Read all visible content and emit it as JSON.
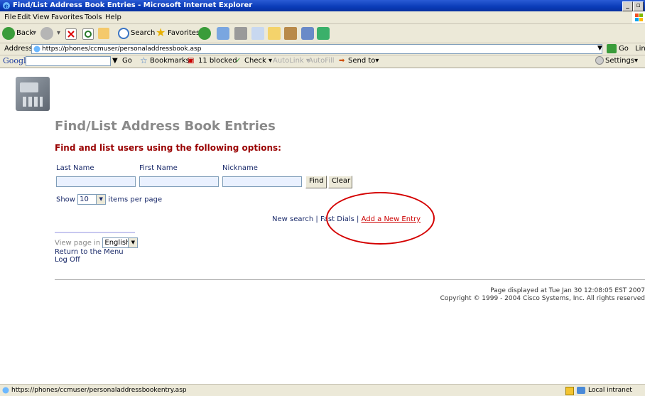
{
  "window": {
    "title": "Find/List Address Book Entries - Microsoft Internet Explorer"
  },
  "menu": [
    "File",
    "Edit",
    "View",
    "Favorites",
    "Tools",
    "Help"
  ],
  "toolbar": {
    "back": "Back",
    "search": "Search",
    "favorites": "Favorites"
  },
  "address": {
    "label": "Address",
    "url": "https://phones/ccmuser/personaladdressbook.asp",
    "go": "Go",
    "links": "Links"
  },
  "googlebar": {
    "logo": "Google",
    "go": "Go",
    "bookmarks": "Bookmarks▾",
    "blocked": "11 blocked",
    "check": "Check ▾",
    "autolink": "AutoLink ▾",
    "autofill": "AutoFill",
    "sendto": "Send to▾",
    "settings": "Settings▾"
  },
  "page": {
    "heading": "Find/List Address Book Entries",
    "subheading": "Find and list users using the following options:",
    "fields": {
      "last_name": "Last Name",
      "first_name": "First Name",
      "nickname": "Nickname"
    },
    "buttons": {
      "find": "Find",
      "clear": "Clear"
    },
    "show": {
      "prefix": "Show",
      "value": "10",
      "suffix": "items per page"
    },
    "links": {
      "new_search": "New search",
      "sep": "|",
      "fast_dials": "Fast Dials",
      "add_new": "Add a New Entry"
    },
    "view_page_in": "View page in",
    "language": "English",
    "return_menu": "Return to the Menu",
    "log_off": "Log Off",
    "footer": {
      "line1": "Page displayed at Tue Jan 30 12:08:05 EST 2007",
      "line2": "Copyright © 1999 - 2004 Cisco Systems, Inc. All rights reserved"
    }
  },
  "status": {
    "url": "https://phones/ccmuser/personaladdressbookentry.asp",
    "zone": "Local intranet"
  }
}
